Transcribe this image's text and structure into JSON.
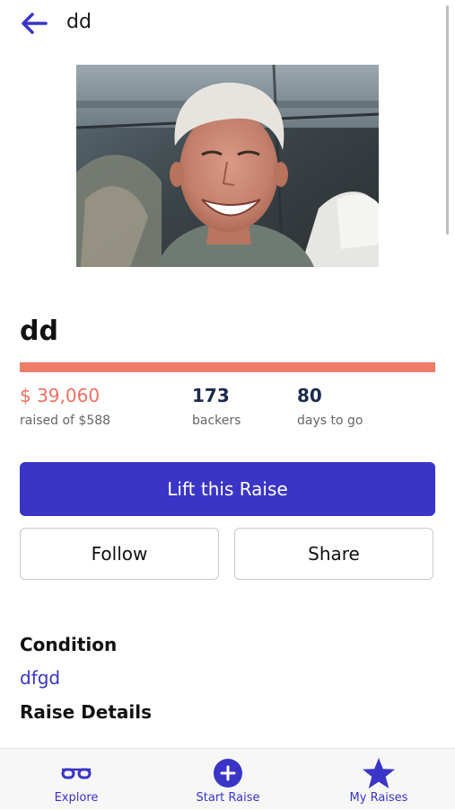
{
  "header": {
    "title": "dd",
    "back_icon": "arrow-left-icon"
  },
  "raise": {
    "title": "dd",
    "image_alt": "Smiling man with gray hair",
    "progress_fraction": 1.0,
    "amount": "$ 39,060",
    "amount_caption": "raised of $588",
    "backers": "173",
    "backers_caption": "backers",
    "days": "80",
    "days_caption": "days to go"
  },
  "actions": {
    "primary_label": "Lift this Raise",
    "follow_label": "Follow",
    "share_label": "Share"
  },
  "sections": {
    "condition_heading": "Condition",
    "condition_value": "dfgd",
    "details_heading": "Raise Details"
  },
  "bottom_nav": {
    "items": [
      {
        "label": "Explore",
        "icon": "glasses-icon"
      },
      {
        "label": "Start Raise",
        "icon": "plus-circle-icon"
      },
      {
        "label": "My Raises",
        "icon": "star-icon"
      }
    ]
  },
  "colors": {
    "accent": "#3a35c7",
    "progress": "#f07c68",
    "amount": "#f07060",
    "stat_dark": "#1b2b4d"
  }
}
